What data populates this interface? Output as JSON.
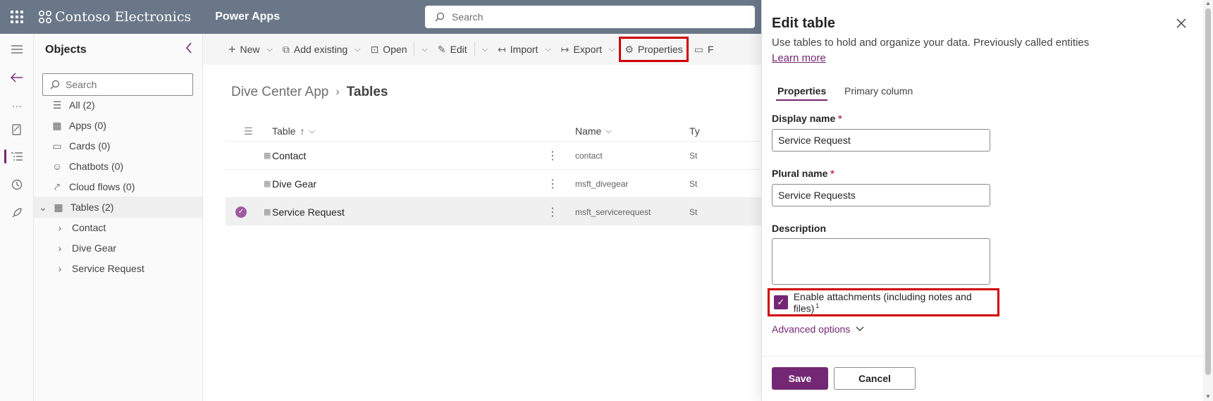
{
  "topbar": {
    "brand": "Contoso Electronics",
    "app": "Power Apps",
    "search_placeholder": "Search"
  },
  "objects": {
    "title": "Objects",
    "search_placeholder": "Search",
    "items": [
      {
        "label": "All",
        "count": "(2)"
      },
      {
        "label": "Apps",
        "count": "(0)"
      },
      {
        "label": "Cards",
        "count": "(0)"
      },
      {
        "label": "Chatbots",
        "count": "(0)"
      },
      {
        "label": "Cloud flows",
        "count": "(0)"
      },
      {
        "label": "Tables",
        "count": "(2)"
      }
    ],
    "tables_children": [
      "Contact",
      "Dive Gear",
      "Service Request"
    ]
  },
  "toolbar": {
    "new": "New",
    "add_existing": "Add existing",
    "open": "Open",
    "edit": "Edit",
    "import": "Import",
    "export": "Export",
    "properties": "Properties",
    "partial": "F"
  },
  "breadcrumb": {
    "parent": "Dive Center App",
    "current": "Tables"
  },
  "table": {
    "headers": {
      "table": "Table",
      "sort": "↑",
      "name": "Name",
      "type": "Ty"
    },
    "rows": [
      {
        "display": "Contact",
        "logical": "contact",
        "type": "St",
        "selected": false
      },
      {
        "display": "Dive Gear",
        "logical": "msft_divegear",
        "type": "St",
        "selected": false
      },
      {
        "display": "Service Request",
        "logical": "msft_servicerequest",
        "type": "St",
        "selected": true
      }
    ]
  },
  "panel": {
    "title": "Edit table",
    "description": "Use tables to hold and organize your data. Previously called entities",
    "learn_more": "Learn more",
    "tabs": [
      "Properties",
      "Primary column"
    ],
    "display_name_label": "Display name",
    "display_name_value": "Service Request",
    "plural_name_label": "Plural name",
    "plural_name_value": "Service Requests",
    "description_label": "Description",
    "description_value": "",
    "required_mark": "*",
    "attachments_label": "Enable attachments (including notes and files)",
    "attachments_sup": "1",
    "attachments_checked": true,
    "advanced": "Advanced options",
    "save": "Save",
    "cancel": "Cancel"
  },
  "colors": {
    "accent": "#742774",
    "topbar": "#6a7788",
    "highlight": "#d00000"
  }
}
